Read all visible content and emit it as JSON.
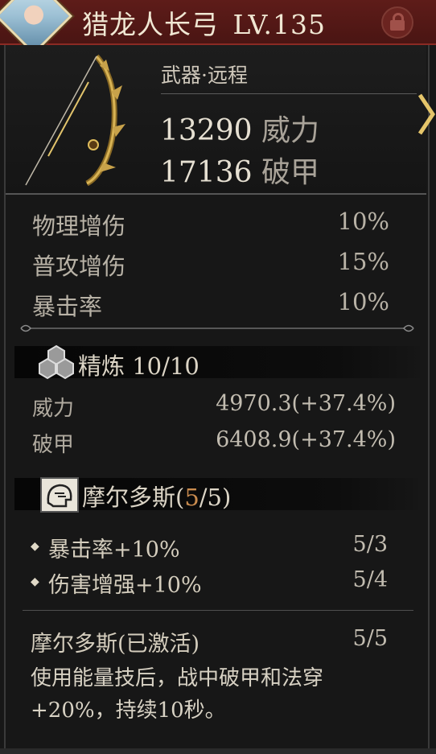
{
  "header": {
    "item_name": "猎龙人长弓",
    "level": "LV.135",
    "lock_icon": "lock-icon"
  },
  "weapon": {
    "type": "武器·远程",
    "stats": [
      {
        "value": "13290",
        "label": "威力"
      },
      {
        "value": "17136",
        "label": "破甲"
      }
    ]
  },
  "attributes": [
    {
      "label": "物理增伤",
      "value": "10%"
    },
    {
      "label": "普攻增伤",
      "value": "15%"
    },
    {
      "label": "暴击率",
      "value": "10%"
    }
  ],
  "refine": {
    "icon": "refine-icon",
    "label": "精炼",
    "progress": "10/10",
    "stats": [
      {
        "label": "威力",
        "value": "4970.3(+37.4%)"
      },
      {
        "label": "破甲",
        "value": "6408.9(+37.4%)"
      }
    ]
  },
  "set": {
    "icon": "set-helmet-icon",
    "name": "摩尔多斯(",
    "count": "5",
    "total": "/5)",
    "count_color": "#c98b4e",
    "bonuses": [
      {
        "text": "暴击率+10%",
        "value": "5/3"
      },
      {
        "text": "伤害增强+10%",
        "value": "5/4"
      }
    ],
    "active": {
      "label": "摩尔多斯(已激活)",
      "value": "5/5",
      "description_line1": "使用能量技后，战中破甲和法穿",
      "description_line2": "+20%，持续10秒。"
    }
  },
  "colors": {
    "header_bg": "#4a1513",
    "panel_bg": "#171717",
    "accent_gold": "#c8a24a"
  }
}
